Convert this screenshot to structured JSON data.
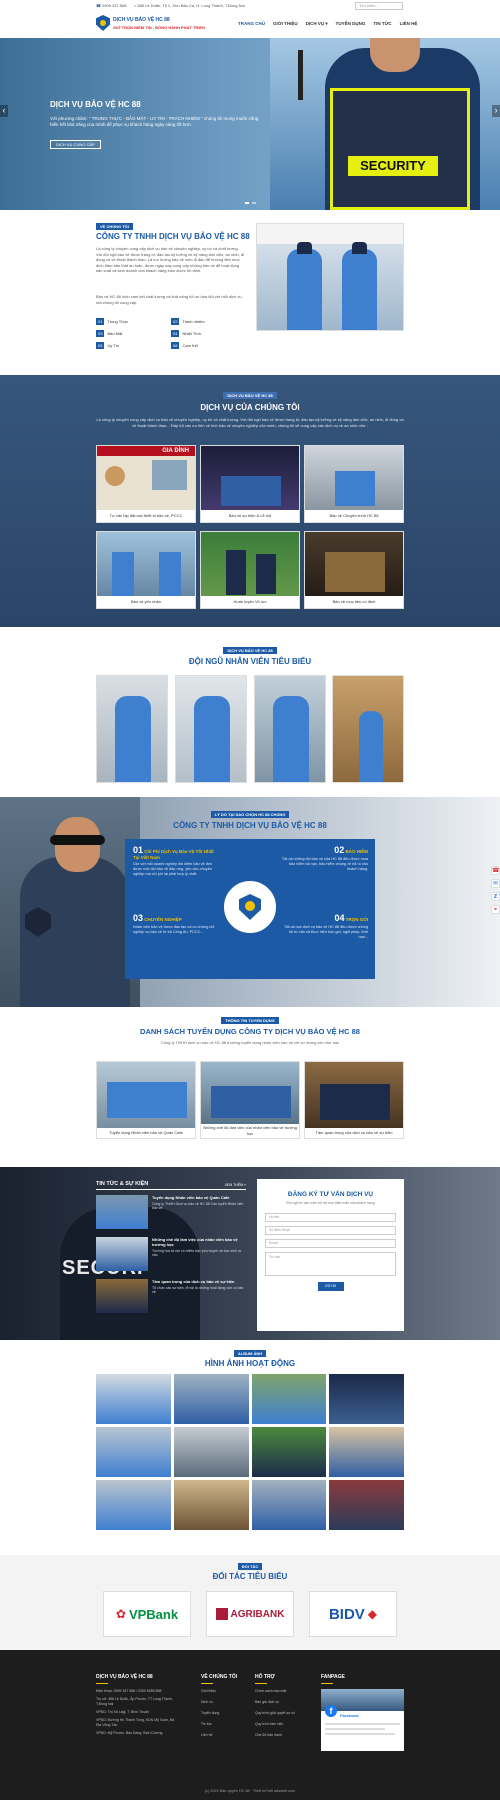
{
  "header": {
    "phone": "0909.337.588",
    "address": "388 Lê Duẩn, Tổ 2, Khu Bảo Cá, H. Long Thành, T.Đồng Nai",
    "search_placeholder": "Tìm kiếm...",
    "brand_name": "DỊCH VỤ BẢO VỆ HC 88",
    "brand_slogan": "GIỮ TRỌN NIỀM TIN - ĐỒNG HÀNH PHÁT TRIỂN",
    "nav": [
      "TRANG CHỦ",
      "GIỚI THIỆU",
      "DỊCH VỤ",
      "TUYỂN DỤNG",
      "TIN TỨC",
      "LIÊN HỆ"
    ]
  },
  "hero": {
    "title": "DỊCH VỤ BẢO VỆ HC 88",
    "text": "Với phương châm: \" TRUNG THỰC - BẢO MẬT - UY TÍN - TRÁCH NHIỆM \" chúng tôi mong muốn cống hiến hết khả năng của mình để phục vụ khách hàng ngày càng tốt hơn.",
    "button": "DỊCH VỤ CUNG CẤP",
    "prev": "‹",
    "next": "›",
    "vest_text": "SECURITY"
  },
  "about": {
    "tag": "VỀ CHÚNG TÔI",
    "title": "CÔNG TY TNHH DỊCH VỤ BẢO VỆ HC 88",
    "p1": "Là công ty chuyên cung cấp dịch vụ bảo vệ chuyên nghiệp, uy tín và chất lượng. Với đội ngũ bảo vệ được trang bị, đào tạo kỹ lưỡng về kỹ năng làm việc, an ninh, đi đúng và về thuật thành thạo. Là lực lượng bảo vệ luôn đi đầu để hướng đến mục đích đảm bảo thật an toàn, được ngày nay cung cấp những bảo vệ để hoạt động sản xuất và kinh doanh của khách hàng luôn được ổn định.",
    "p2": "Bảo vệ HC 88 luôn cam kết chất lượng và khả năng tối ưu hóa đối với mỗi dịch vụ mà chúng tôi cung cấp.",
    "values": [
      {
        "num": "01",
        "label": "Trung Thực"
      },
      {
        "num": "02",
        "label": "Trách nhiệm"
      },
      {
        "num": "03",
        "label": "Bảo Mật"
      },
      {
        "num": "04",
        "label": "Nhiệt Tình"
      },
      {
        "num": "05",
        "label": "Uy Tín"
      },
      {
        "num": "06",
        "label": "Cam Kết"
      }
    ]
  },
  "services": {
    "tag": "DỊCH VỤ BẢO VỆ HC 88",
    "title": "DỊCH VỤ CỦA CHÚNG TÔI",
    "intro": "Là công ty chuyên cung cấp dịch vụ bảo vệ chuyên nghiệp, uy tín và chất lượng. Với đội ngũ bảo vệ được trang bị, đào tạo kỹ lưỡng về kỹ năng làm việc, an ninh, đi đúng và về thuật thành thạo... Đáp tốt các ưu tiên về tính bảo vệ chuyên nghiệp của mình, chúng tôi sẽ cung cấp các dịch vụ về an ninh như :",
    "banner": "GIA ĐÌNH",
    "items": [
      "Tư vấn lập đặt các thiết bị bảo vệ, PCCC",
      "Bảo vệ sự kiện & Lễ hội",
      "Bảo vệ Chuyên trình HC 88",
      "Bảo vệ yếu nhân",
      "Huấn luyện Võ lực",
      "Bảo vệ mục tiêu cố định"
    ]
  },
  "team": {
    "tag": "DỊCH VỤ BẢO VỆ HC 88",
    "title": "ĐỘI NGŨ NHÂN VIÊN TIÊU BIỂU"
  },
  "why": {
    "tag": "LÝ DO TẠI SAO CHỌN HC 88 CHÚNG",
    "title": "CÔNG TY TNHH DỊCH VỤ BẢO VỆ HC 88",
    "items": [
      {
        "num": "01",
        "head": "Chi Phí Dịch Vụ Bảo Vệ Tốt Nhất Tại Việt Nam",
        "text": "Giờ với mỗi doanh nghiệp tìm kiếm bảo vệ làm được một đội bảo vệ đáp ứng, yêu cầu chuyên nghiệp mà chi phí lại phải hợp lý nhất."
      },
      {
        "num": "02",
        "head": "BẢO HIỂM",
        "text": "Tất cả những đội bảo vệ của HC 88 đều được mua bảo hiểm tai nạn, bảo hiểm chung về rủi ro cho khách hàng."
      },
      {
        "num": "03",
        "head": "CHUYÊN NGHIỆP",
        "text": "Nhân viên bảo vệ được đào tạo và có chứng chỉ nghiệp vụ bảo vệ từ bộ Công An, PCCC..."
      },
      {
        "num": "04",
        "head": "TRỌN GÓI",
        "text": "Tất cả mọi dịch vụ bảo vệ HC 88 đều được chúng tôi tư vấn và thực hiện trọn gói, nghỉ phép, thời hạn..."
      }
    ]
  },
  "recruit": {
    "tag": "THÔNG TIN TUYỂN DỤNG",
    "title": "DANH SÁCH TUYỂN DỤNG CÔNG TY DỊCH VỤ BẢO VỆ HC 88",
    "sub": "Công ty TNHH dịch vụ bảo vệ HC 88 thường tuyển dụng nhân viên bảo vệ với số lượng lớn như sau",
    "items": [
      "Tuyển dụng Nhân viên bảo vệ Quán Cafe",
      "Những chế độ làm việc của nhân viên bảo vệ trường học",
      "Tầm quan trọng của dịch vụ bảo vệ sự kiện"
    ]
  },
  "news": {
    "title": "TIN TỨC & SỰ KIỆN",
    "more": "XEM THÊM »",
    "items": [
      {
        "title": "Tuyển dụng Nhân viên bảo vệ Quán Cafe",
        "text": "Công ty TNHH Dịch vụ bảo vệ HC 88 Cần tuyển Nhân viên bảo vệ"
      },
      {
        "title": "Những chế độ làm việc của nhân viên bảo vệ trường học",
        "text": "Trường học là nơi có nhiều bậc phụ huynh và học sinh ra vào"
      },
      {
        "title": "Tầm quan trọng của dịch vụ bảo vệ sự kiện",
        "text": "Tổ chức các sự kiện, lễ hội là những hoạt động cần có bảo vệ"
      }
    ]
  },
  "form": {
    "title": "ĐĂNG KÝ TƯ VẤN DỊCH VỤ",
    "sub": "Đội ngũ tư vấn luôn hỗ trợ mọi thắc mắc của khách hàng",
    "name_placeholder": "Họ tên",
    "phone_placeholder": "Số điện thoại",
    "email_placeholder": "Email",
    "message_placeholder": "Tư vấn",
    "submit": "GỬI ĐI",
    "vest_text": "SECURI"
  },
  "gallery": {
    "tag": "ALBUM ẢNH",
    "title": "HÌNH ẢNH HOẠT ĐỘNG"
  },
  "partners": {
    "tag": "ĐỐI TÁC",
    "title": "ĐỐI TÁC TIÊU BIỂU",
    "items": [
      {
        "name": "VPBank",
        "color": "#00923f"
      },
      {
        "name": "AGRIBANK",
        "color": "#a91d3a"
      },
      {
        "name": "BIDV",
        "color": "#1c5aa6"
      }
    ]
  },
  "footer": {
    "col1_title": "DỊCH VỤ BẢO VỆ HC 88",
    "col1": [
      "Điện thoại: 0909 337 588 / 0250 8288 888",
      "Trụ sở: 388 Lê Duẩn, Ấp Phước, TT Long Thành, T.Đồng Nai",
      "VPĐD: Thị Xã Lagi, T. Bình Thuận",
      "VPĐD: Đường Hồ Thanh Tùng, KDN Mỹ Xuân, Bà Rịa Vũng Tàu",
      "VPĐD: Mỹ Phước, Bàu Bàng, Bình Dương"
    ],
    "col2_title": "VỀ CHÚNG TÔI",
    "col2": [
      "Giới thiệu",
      "Dịch vụ",
      "Tuyển dụng",
      "Tin tức",
      "Liên hệ"
    ],
    "col3_title": "HỖ TRỢ",
    "col3": [
      "Chính sách bảo mật",
      "Bảo giá dịch vụ",
      "Quy trình giải quyết sự cố",
      "Quy trình làm việc",
      "Chế độ bảo hành"
    ],
    "col4_title": "FANPAGE",
    "fb_name": "Facebook",
    "copyright": "(c) 2021 Bản quyền HC 88 · Thiết kế bởi adsweb.com"
  },
  "colors": {
    "primary": "#1c5aa6",
    "accent": "#d9262c",
    "dark": "#1a1a1a"
  }
}
